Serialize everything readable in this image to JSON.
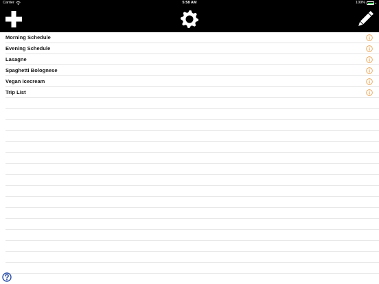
{
  "status_bar": {
    "carrier": "Carrier",
    "time": "5:58 AM",
    "battery_percent": "100%",
    "wifi_icon": "wifi-icon",
    "battery_icon": "battery-icon"
  },
  "toolbar": {
    "add_icon": "plus-icon",
    "settings_icon": "gear-icon",
    "edit_icon": "pencil-icon"
  },
  "list": {
    "items": [
      {
        "label": "Morning Schedule"
      },
      {
        "label": "Evening Schedule"
      },
      {
        "label": "Lasagne"
      },
      {
        "label": "Spaghetti Bolognese"
      },
      {
        "label": "Vegan Icecream"
      },
      {
        "label": "Trip List"
      }
    ],
    "detail_icon": "info-icon"
  },
  "footer": {
    "help_icon": "question-icon"
  },
  "colors": {
    "toolbar_bg": "#000000",
    "accent": "#e8963a",
    "help": "#2a4fa8",
    "battery": "#4cd964",
    "separator": "#e3e3e3"
  }
}
